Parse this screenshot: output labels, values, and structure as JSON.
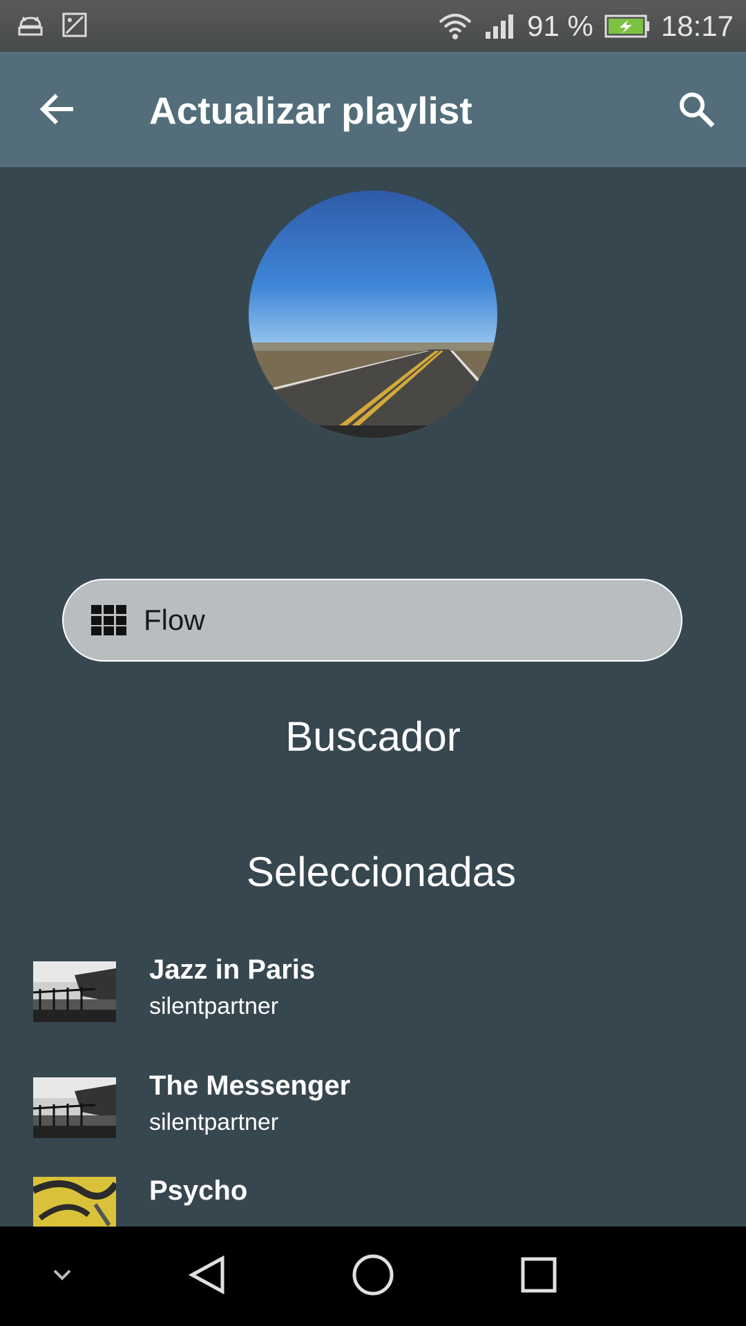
{
  "status_bar": {
    "battery_percent": "91 %",
    "time": "18:17",
    "icons": [
      "android-debug-icon",
      "gallery-icon",
      "wifi-icon",
      "signal-icon",
      "battery-charging-icon"
    ]
  },
  "app_bar": {
    "title": "Actualizar playlist",
    "back_icon": "arrow-back-icon",
    "search_icon": "search-icon"
  },
  "cover": {
    "description_icon": "road-photo"
  },
  "flow_button": {
    "label": "Flow",
    "icon": "grid-icon"
  },
  "sections": {
    "search_label": "Buscador",
    "selected_label": "Seleccionadas"
  },
  "tracks": [
    {
      "title": "Jazz in Paris",
      "artist": "silentpartner",
      "thumb": "pier-photo"
    },
    {
      "title": "The Messenger",
      "artist": "silentpartner",
      "thumb": "pier-photo"
    },
    {
      "title": "Psycho",
      "artist": "",
      "thumb": "yellow-abstract-photo"
    }
  ],
  "nav_bar": {
    "icons": [
      "chevron-down-icon",
      "back-triangle-icon",
      "home-circle-icon",
      "recents-square-icon"
    ]
  },
  "colors": {
    "background": "#37474f",
    "app_bar": "#536e7a",
    "pill": "#b9bdc0"
  }
}
